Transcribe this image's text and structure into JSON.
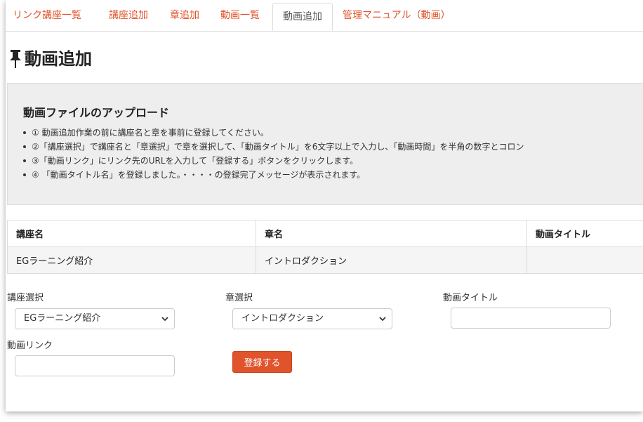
{
  "tabs": [
    {
      "label": "リンク講座一覧",
      "active": false
    },
    {
      "label": "講座追加",
      "active": false
    },
    {
      "label": "章追加",
      "active": false
    },
    {
      "label": "動画一覧",
      "active": false
    },
    {
      "label": "動画追加",
      "active": true
    },
    {
      "label": "管理マニュアル（動画）",
      "active": false
    }
  ],
  "page": {
    "title": "動画追加",
    "icon": "pushpin-icon"
  },
  "instructions": {
    "heading": "動画ファイルのアップロード",
    "steps": [
      "① 動画追加作業の前に講座名と章を事前に登録してください。",
      "②「講座選択」で講座名と「章選択」で章を選択して、「動画タイトル」を6文字以上で入力し、「動画時間」を半角の数字とコロン",
      "③「動画リンク」にリンク先のURLを入力して「登録する」ボタンをクリックします。",
      "④ 「動画タイトル名」を登録しました。・・・・の登録完了メッセージが表示されます。"
    ]
  },
  "table": {
    "headers": [
      "講座名",
      "章名",
      "動画タイトル"
    ],
    "rows": [
      [
        "EGラーニング紹介",
        "イントロダクション",
        ""
      ]
    ]
  },
  "form": {
    "course_label": "講座選択",
    "course_value": "EGラーニング紹介",
    "chapter_label": "章選択",
    "chapter_value": "イントロダクション",
    "title_label": "動画タイトル",
    "title_value": "",
    "link_label": "動画リンク",
    "link_value": "",
    "submit_label": "登録する"
  },
  "colors": {
    "accent": "#e0532b",
    "panel_bg": "#eeeeee",
    "border": "#dddddd"
  }
}
